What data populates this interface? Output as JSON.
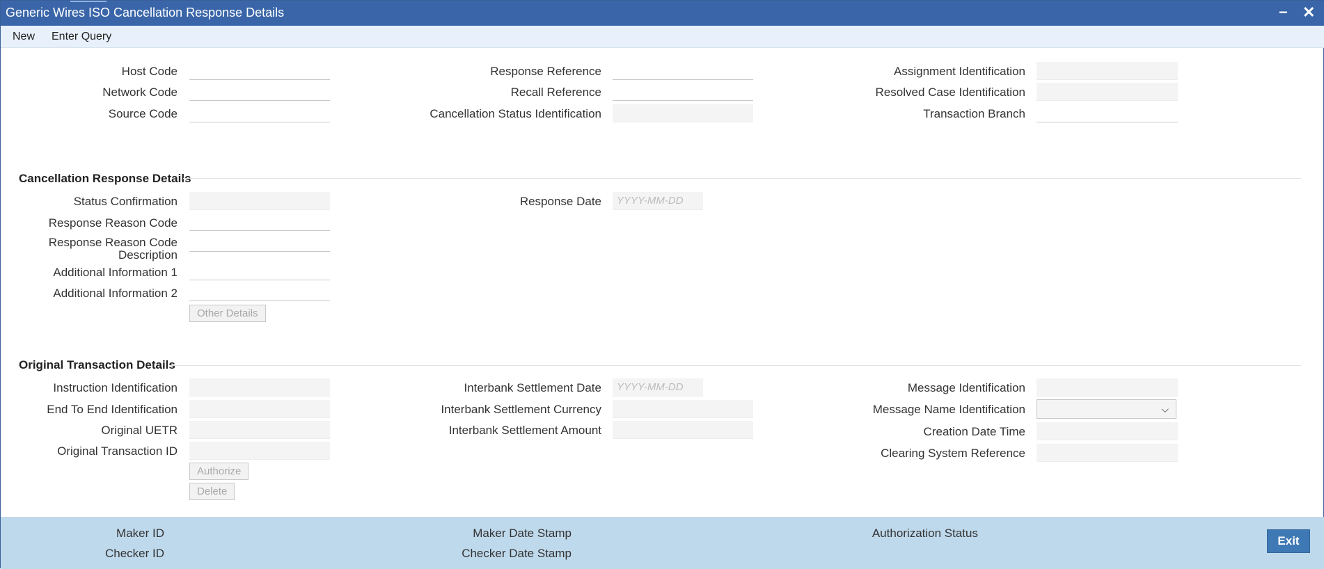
{
  "window": {
    "title": "Generic Wires ISO Cancellation Response Details",
    "minimize_icon": "minus-icon",
    "close_icon": "close-icon"
  },
  "menu": {
    "new_label": "New",
    "enter_query_label": "Enter Query"
  },
  "header": {
    "host_code_label": "Host Code",
    "network_code_label": "Network Code",
    "source_code_label": "Source Code",
    "response_reference_label": "Response Reference",
    "recall_reference_label": "Recall Reference",
    "cancellation_status_identification_label": "Cancellation Status Identification",
    "assignment_identification_label": "Assignment Identification",
    "resolved_case_identification_label": "Resolved Case Identification",
    "transaction_branch_label": "Transaction Branch"
  },
  "cancellation": {
    "section_title": "Cancellation Response Details",
    "status_confirmation_label": "Status Confirmation",
    "response_reason_code_label": "Response Reason Code",
    "response_reason_code_description_label": "Response Reason Code Description",
    "additional_information_1_label": "Additional Information 1",
    "additional_information_2_label": "Additional Information 2",
    "other_details_button": "Other Details",
    "response_date_label": "Response Date",
    "response_date_placeholder": "YYYY-MM-DD"
  },
  "original": {
    "section_title": "Original Transaction Details",
    "instruction_identification_label": "Instruction Identification",
    "end_to_end_identification_label": "End To End Identification",
    "original_uetr_label": "Original UETR",
    "original_transaction_id_label": "Original Transaction ID",
    "authorize_button": "Authorize",
    "delete_button": "Delete",
    "interbank_settlement_date_label": "Interbank Settlement Date",
    "interbank_settlement_date_placeholder": "YYYY-MM-DD",
    "interbank_settlement_currency_label": "Interbank Settlement Currency",
    "interbank_settlement_amount_label": "Interbank Settlement Amount",
    "message_identification_label": "Message Identification",
    "message_name_identification_label": "Message Name Identification",
    "message_name_identification_value": "",
    "creation_date_time_label": "Creation Date Time",
    "clearing_system_reference_label": "Clearing System Reference"
  },
  "footer": {
    "maker_id_label": "Maker ID",
    "checker_id_label": "Checker ID",
    "maker_date_stamp_label": "Maker Date Stamp",
    "checker_date_stamp_label": "Checker Date Stamp",
    "authorization_status_label": "Authorization Status",
    "exit_button": "Exit"
  },
  "colors": {
    "title_bar": "#3a66a9",
    "footer": "#bfd9ec",
    "exit_button": "#3f79b5"
  }
}
